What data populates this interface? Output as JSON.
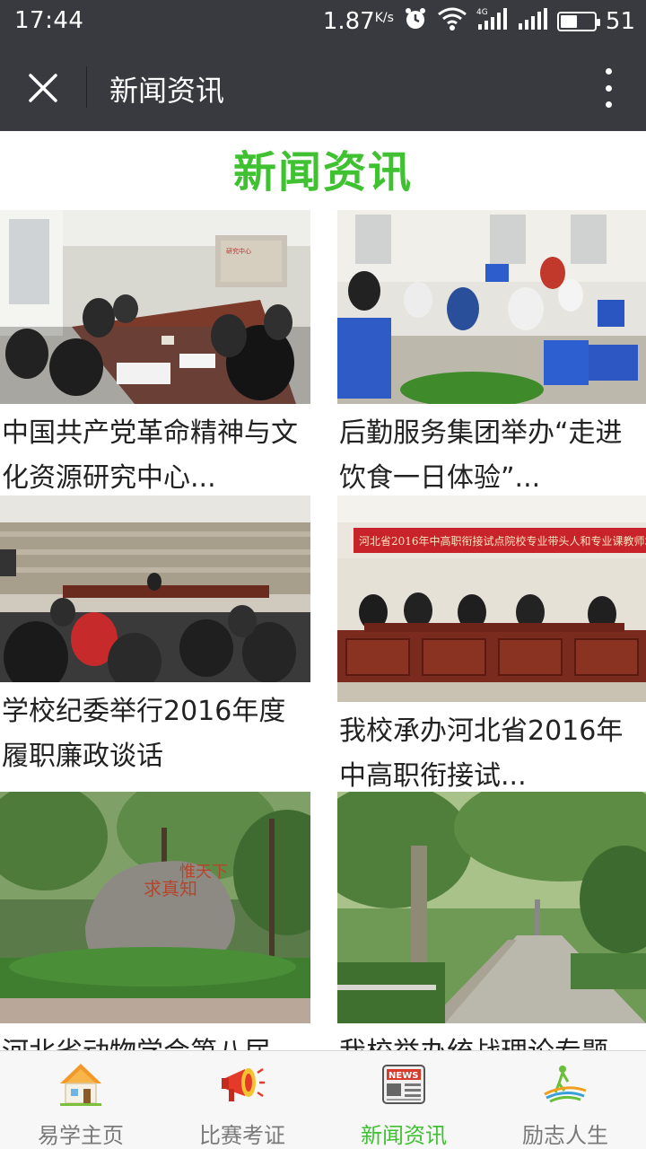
{
  "status": {
    "time": "17:44",
    "speed": "1.87",
    "speed_unit": "K/s",
    "battery": "51",
    "battery_level": 0.51,
    "icons": [
      "alarm-icon",
      "wifi-icon",
      "4g-signal-icon",
      "signal-icon",
      "battery-icon"
    ]
  },
  "titlebar": {
    "title": "新闻资讯",
    "close_icon": "close-icon",
    "more_icon": "more-vertical-icon"
  },
  "page": {
    "heading": "新闻资讯",
    "accent_color": "#3fc132"
  },
  "news": [
    {
      "title": "中国共产党革命精神与文化资源研究中心...",
      "image": "meeting-room-photo"
    },
    {
      "title": "后勤服务集团举办“走进饮食一日体验”...",
      "image": "kitchen-vegetables-photo"
    },
    {
      "title": "学校纪委举行2016年度履职廉政谈话",
      "image": "auditorium-meeting-photo"
    },
    {
      "title": "我校承办河北省2016年中高职衔接试...",
      "image": "conference-banner-photo"
    },
    {
      "title": "河北省动物学会第八届",
      "image": "campus-stone-photo"
    },
    {
      "title": "我校举办统战理论专题",
      "image": "tree-lined-road-photo"
    }
  ],
  "nav": {
    "items": [
      {
        "label": "易学主页",
        "icon": "home-icon"
      },
      {
        "label": "比赛考证",
        "icon": "megaphone-icon"
      },
      {
        "label": "新闻资讯",
        "icon": "newspaper-icon"
      },
      {
        "label": "励志人生",
        "icon": "inspire-logo-icon"
      }
    ],
    "active_index": 2
  }
}
